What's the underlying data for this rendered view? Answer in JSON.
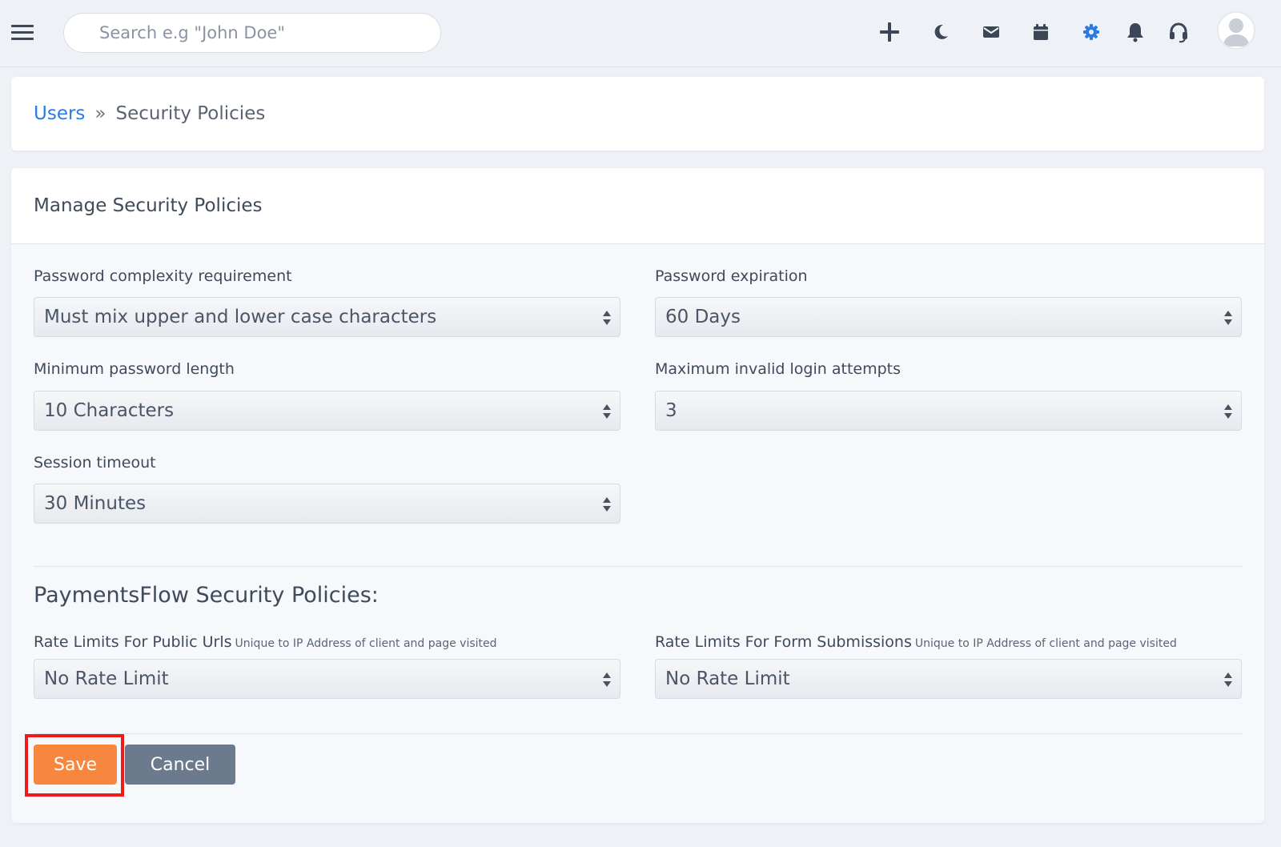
{
  "topbar": {
    "search_placeholder": "Search e.g \"John Doe\"",
    "icons": [
      "menu-icon",
      "plus-icon",
      "moon-icon",
      "mail-icon",
      "calendar-icon",
      "gear-icon",
      "bell-icon",
      "support-icon",
      "avatar"
    ],
    "accent_color": "#2c7be5"
  },
  "breadcrumb": {
    "parent": "Users",
    "separator": "»",
    "current": "Security Policies"
  },
  "main": {
    "title": "Manage Security Policies",
    "fields": {
      "password_complexity": {
        "label": "Password complexity requirement",
        "value": "Must mix upper and lower case characters"
      },
      "password_expiration": {
        "label": "Password expiration",
        "value": "60 Days"
      },
      "min_password_length": {
        "label": "Minimum password length",
        "value": "10 Characters"
      },
      "max_invalid_logins": {
        "label": "Maximum invalid login attempts",
        "value": "3"
      },
      "session_timeout": {
        "label": "Session timeout",
        "value": "30 Minutes"
      }
    },
    "payments_section": {
      "title": "PaymentsFlow Security Policies:",
      "public_urls": {
        "label": "Rate Limits For Public Urls",
        "hint": "Unique to IP Address of client and page visited",
        "value": "No Rate Limit"
      },
      "form_submissions": {
        "label": "Rate Limits For Form Submissions",
        "hint": "Unique to IP Address of client and page visited",
        "value": "No Rate Limit"
      }
    },
    "actions": {
      "save_label": "Save",
      "cancel_label": "Cancel",
      "save_color": "#f7873f",
      "cancel_color": "#6c7a8d",
      "highlight_color": "#ee1b1b"
    }
  }
}
